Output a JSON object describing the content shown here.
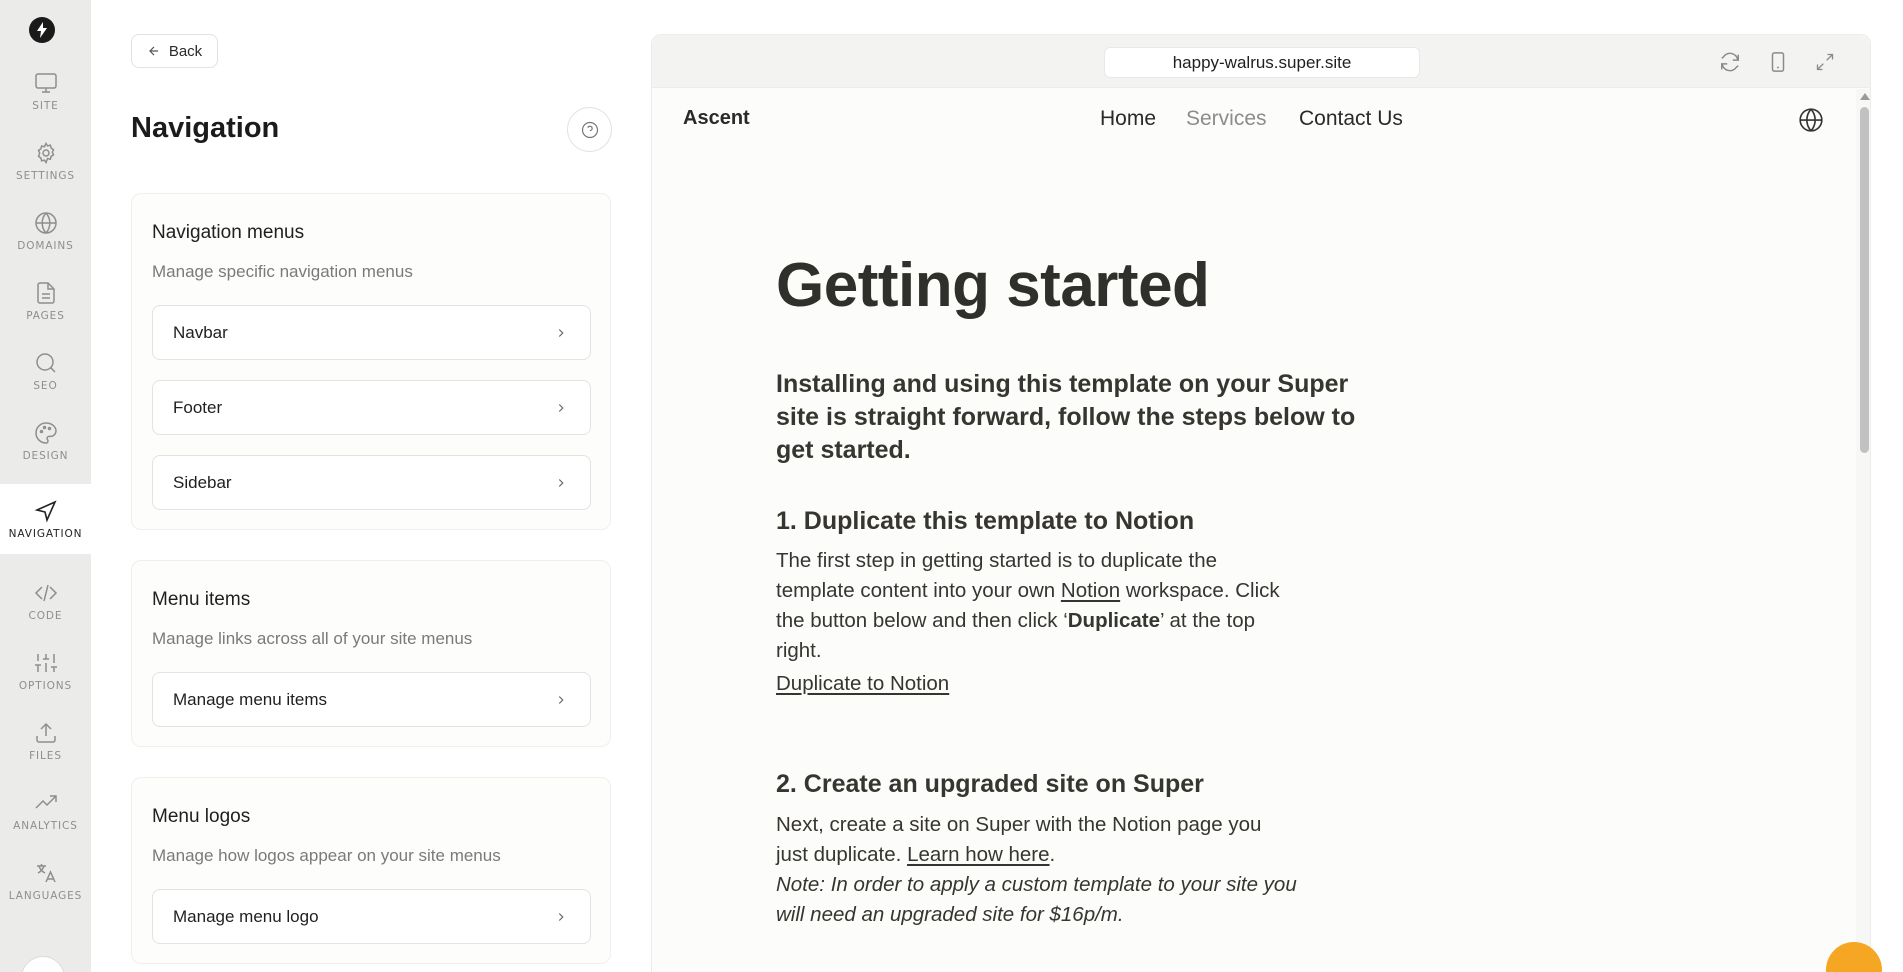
{
  "rail": {
    "items": [
      {
        "label": "SITE",
        "icon": "monitor-icon"
      },
      {
        "label": "SETTINGS",
        "icon": "gear-icon"
      },
      {
        "label": "DOMAINS",
        "icon": "globe-icon"
      },
      {
        "label": "PAGES",
        "icon": "file-icon"
      },
      {
        "label": "SEO",
        "icon": "search-icon"
      },
      {
        "label": "DESIGN",
        "icon": "palette-icon"
      },
      {
        "label": "NAVIGATION",
        "icon": "send-icon"
      },
      {
        "label": "CODE",
        "icon": "code-icon"
      },
      {
        "label": "OPTIONS",
        "icon": "sliders-icon"
      },
      {
        "label": "FILES",
        "icon": "upload-icon"
      },
      {
        "label": "ANALYTICS",
        "icon": "trending-icon"
      },
      {
        "label": "LANGUAGES",
        "icon": "translate-icon"
      }
    ],
    "active": "NAVIGATION"
  },
  "panel": {
    "back_label": "Back",
    "title": "Navigation",
    "sections": [
      {
        "title": "Navigation menus",
        "subtitle": "Manage specific navigation menus",
        "rows": [
          "Navbar",
          "Footer",
          "Sidebar"
        ]
      },
      {
        "title": "Menu items",
        "subtitle": "Manage links across all of your site menus",
        "rows": [
          "Manage menu items"
        ]
      },
      {
        "title": "Menu logos",
        "subtitle": "Manage how logos appear on your site menus",
        "rows": [
          "Manage menu logo"
        ]
      }
    ]
  },
  "preview": {
    "url": "happy-walrus.super.site",
    "site": {
      "logo": "Ascent",
      "nav": [
        {
          "label": "Home"
        },
        {
          "label": "Services"
        },
        {
          "label": "Contact Us"
        }
      ]
    },
    "page": {
      "title": "Getting started",
      "lead": "Installing and using this template on your Super site is straight forward, follow the steps below to get started.",
      "step1": {
        "heading": "1. Duplicate this template to Notion",
        "p1": "The first step in getting started is to duplicate the template content into your own ",
        "p1_link": "Notion",
        "p1_rest": " workspace. Click the button below and then click ‘",
        "p1_bold": "Duplicate",
        "p1_end": "’ at the top right.",
        "cta": "Duplicate to Notion"
      },
      "step2": {
        "heading": "2. Create an upgraded site on Super",
        "p1": "Next, create a site on Super with the Notion page you just duplicate. ",
        "p1_link": "Learn how here",
        "p1_end": ".",
        "note": "Note: In order to apply a custom template to your site you will need an upgraded site for $16p/m."
      }
    }
  },
  "colors": {
    "rail_bg": "#ebebea",
    "accent_fab": "#f5a623",
    "text": "#37352f"
  }
}
